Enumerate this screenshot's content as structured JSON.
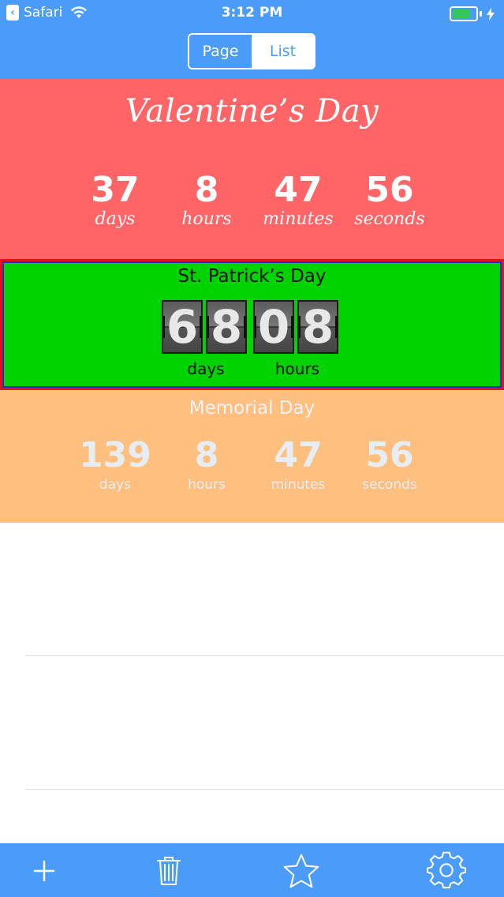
{
  "status_bar": {
    "back_app": "Safari",
    "time": "3:12 PM",
    "battery_level": 0.9
  },
  "nav": {
    "segments": [
      {
        "label": "Page",
        "selected": true
      },
      {
        "label": "List",
        "selected": false
      }
    ]
  },
  "events": [
    {
      "title": "Valentine’s Day",
      "units": [
        {
          "value": "37",
          "label": "days"
        },
        {
          "value": "8",
          "label": "hours"
        },
        {
          "value": "47",
          "label": "minutes"
        },
        {
          "value": "56",
          "label": "seconds"
        }
      ]
    },
    {
      "title": "St. Patrick’s Day",
      "flip_units": [
        {
          "digits": [
            "6",
            "8"
          ],
          "label": "days"
        },
        {
          "digits": [
            "0",
            "8"
          ],
          "label": "hours"
        }
      ]
    },
    {
      "title": "Memorial Day",
      "units": [
        {
          "value": "139",
          "label": "days"
        },
        {
          "value": "8",
          "label": "hours"
        },
        {
          "value": "47",
          "label": "minutes"
        },
        {
          "value": "56",
          "label": "seconds"
        }
      ]
    }
  ],
  "toolbar": {
    "icons": [
      "plus-icon",
      "trash-icon",
      "star-icon",
      "gear-icon"
    ]
  },
  "colors": {
    "accent": "#4a9cf8",
    "valentine_bg": "#ff6567",
    "patrick_bg": "#00d300",
    "memorial_bg": "#ffbf7f"
  }
}
